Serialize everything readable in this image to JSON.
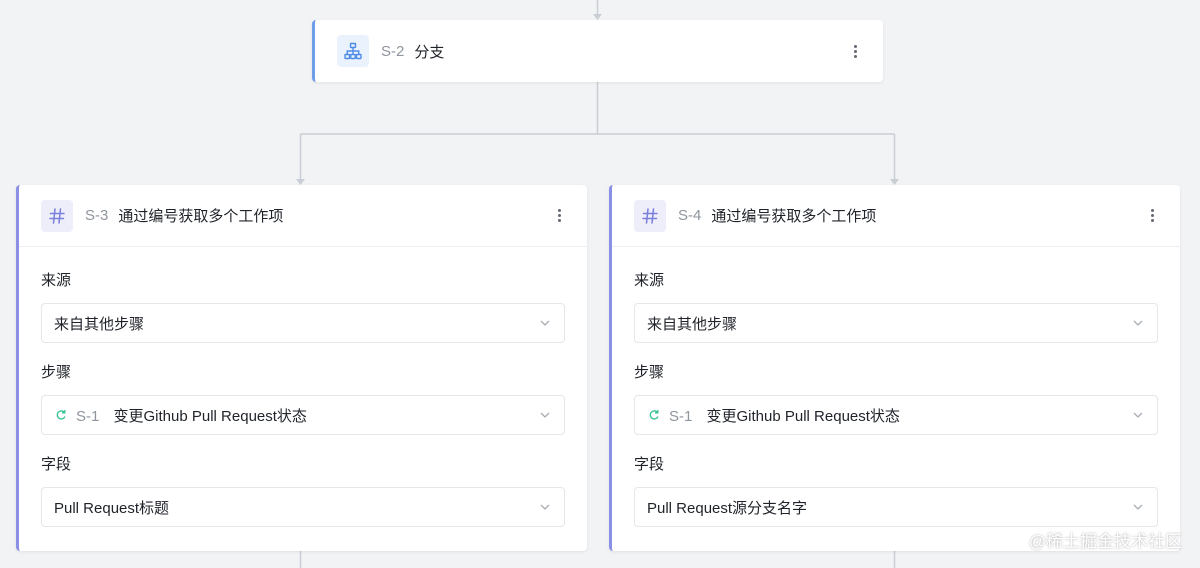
{
  "branch_node": {
    "id": "S-2",
    "title": "分支",
    "icon": "branch-icon"
  },
  "steps": [
    {
      "id": "S-3",
      "title": "通过编号获取多个工作项",
      "icon": "hash-icon",
      "fields": {
        "source_label": "来源",
        "source_value": "来自其他步骤",
        "step_label": "步骤",
        "step_ref_id": "S-1",
        "step_ref_title": "变更Github Pull Request状态",
        "field_label": "字段",
        "field_value": "Pull Request标题"
      }
    },
    {
      "id": "S-4",
      "title": "通过编号获取多个工作项",
      "icon": "hash-icon",
      "fields": {
        "source_label": "来源",
        "source_value": "来自其他步骤",
        "step_label": "步骤",
        "step_ref_id": "S-1",
        "step_ref_title": "变更Github Pull Request状态",
        "field_label": "字段",
        "field_value": "Pull Request源分支名字"
      }
    }
  ],
  "watermark": "@稀土掘金技术社区",
  "colors": {
    "branch_accent": "#6f9ee8",
    "step_accent": "#8b8fe6",
    "connector": "#c9cdd4",
    "ref_icon": "#34c38f"
  }
}
